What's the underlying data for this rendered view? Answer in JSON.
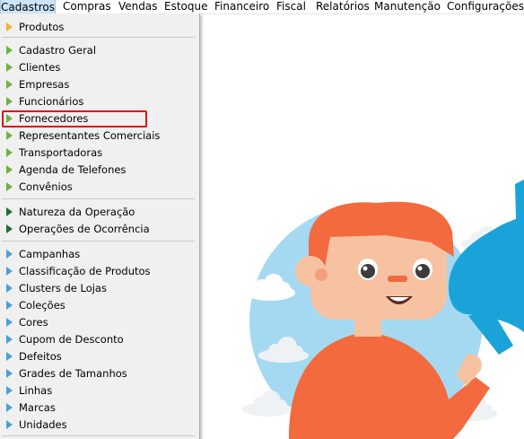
{
  "menubar": {
    "items": [
      {
        "label": "Cadastros"
      },
      {
        "label": "Compras"
      },
      {
        "label": "Vendas"
      },
      {
        "label": "Estoque"
      },
      {
        "label": "Financeiro"
      },
      {
        "label": "Fiscal"
      },
      {
        "label": "Relatórios"
      },
      {
        "label": "Manutenção"
      },
      {
        "label": "Configurações"
      }
    ]
  },
  "menu": {
    "groups": [
      {
        "arrow_color": "#f0b52a",
        "items": [
          {
            "label": "Produtos"
          }
        ]
      },
      {
        "arrow_color": "#6cb33f",
        "items": [
          {
            "label": "Cadastro Geral"
          },
          {
            "label": "Clientes"
          },
          {
            "label": "Empresas"
          },
          {
            "label": "Funcionários"
          },
          {
            "label": "Fornecedores"
          },
          {
            "label": "Representantes Comerciais"
          },
          {
            "label": "Transportadoras"
          },
          {
            "label": "Agenda de Telefones"
          },
          {
            "label": "Convênios"
          }
        ]
      },
      {
        "arrow_color": "#1f6e2b",
        "items": [
          {
            "label": "Natureza da Operação"
          },
          {
            "label": "Operações de Ocorrência"
          }
        ]
      },
      {
        "arrow_color": "#4aa0d8",
        "items": [
          {
            "label": "Campanhas"
          },
          {
            "label": "Classificação de Produtos"
          },
          {
            "label": "Clusters de Lojas"
          },
          {
            "label": "Coleções"
          },
          {
            "label": "Cores"
          },
          {
            "label": "Cupom de Desconto"
          },
          {
            "label": "Defeitos"
          },
          {
            "label": "Grades de Tamanhos"
          },
          {
            "label": "Linhas"
          },
          {
            "label": "Marcas"
          },
          {
            "label": "Unidades"
          }
        ]
      }
    ]
  },
  "illustration": {
    "icons": [
      "person-icon",
      "megaphone-icon",
      "cloud-icon"
    ]
  },
  "colors": {
    "highlight": "#e0101b",
    "menu_bg": "#f0f0f0",
    "active_menu_bg": "#cce4f7"
  }
}
